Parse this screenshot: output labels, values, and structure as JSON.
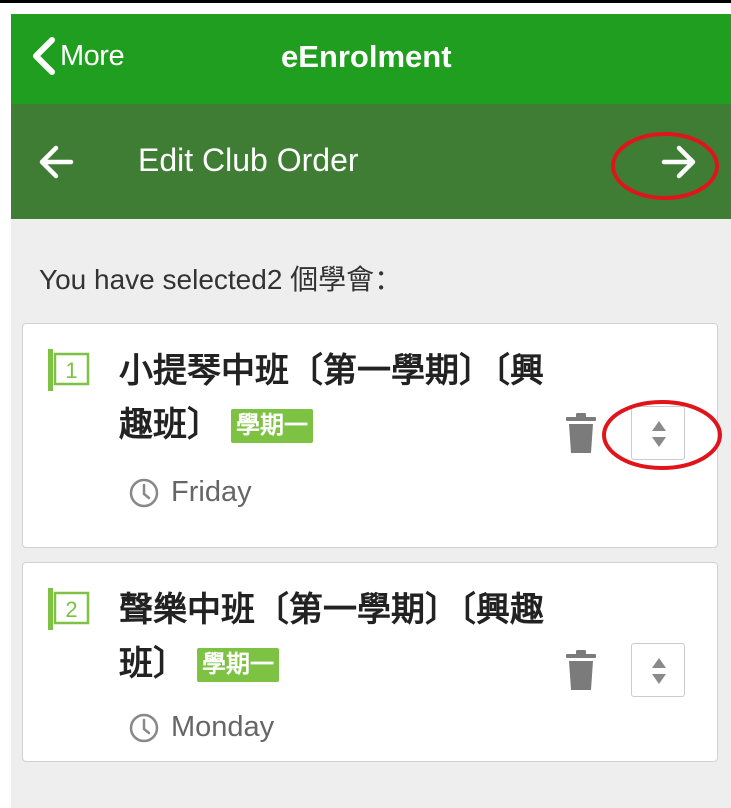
{
  "topbar": {
    "back_label": "More",
    "title": "eEnrolment",
    "color": "#1f9e1f"
  },
  "subbar": {
    "title": "Edit Club Order",
    "color": "#3f7d35",
    "back_icon": "arrow-left-icon",
    "next_icon": "arrow-right-icon"
  },
  "selection": {
    "text": "You have selected2 個學會："
  },
  "clubs": [
    {
      "order": "1",
      "name": "小提琴中班〔第一學期〕〔興趣班〕",
      "term": "學期一",
      "day": "Friday"
    },
    {
      "order": "2",
      "name": "聲樂中班〔第一學期〕〔興趣班〕",
      "term": "學期一",
      "day": "Monday"
    }
  ],
  "annotations": {
    "circle_color": "#e0141b",
    "highlights": [
      "next-arrow-button",
      "reorder-handle-1"
    ]
  }
}
